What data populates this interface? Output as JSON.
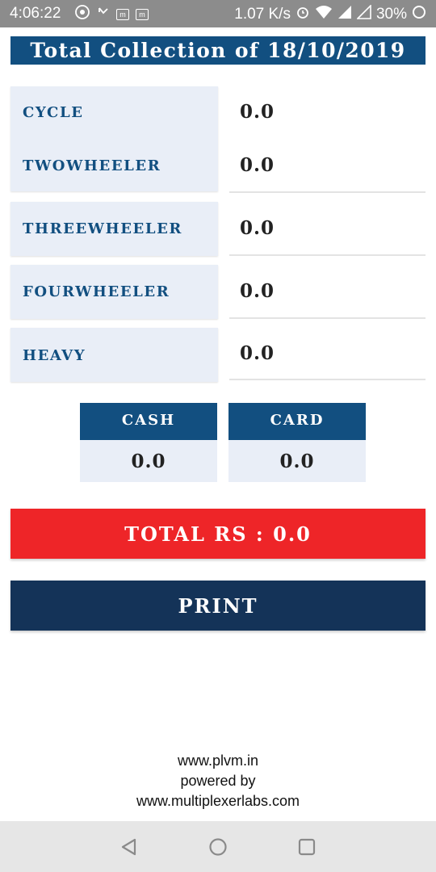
{
  "status_bar": {
    "time": "4:06:22",
    "network_speed": "1.07 K/s",
    "battery": "30%",
    "icons": [
      "music-icon",
      "missed-call-icon",
      "m-app-icon",
      "m-app-icon",
      "alarm-icon",
      "wifi-icon",
      "signal-icon",
      "signal-icon",
      "battery-icon"
    ],
    "app_icon_letter": "m"
  },
  "header": {
    "title": "Total Collection of 18/10/2019"
  },
  "categories": [
    {
      "label": "CYCLE",
      "value": "0.0"
    },
    {
      "label": "TWOWHEELER",
      "value": "0.0"
    },
    {
      "label": "THREEWHEELER",
      "value": "0.0"
    },
    {
      "label": "FOURWHEELER",
      "value": "0.0"
    },
    {
      "label": "HEAVY",
      "value": "0.0"
    }
  ],
  "payment": {
    "cash_label": "CASH",
    "cash_value": "0.0",
    "card_label": "CARD",
    "card_value": "0.0"
  },
  "total": {
    "text": "TOTAL RS : 0.0"
  },
  "print_button": {
    "label": "PRINT"
  },
  "footer": {
    "line1": "www.plvm.in",
    "line2": "powered by",
    "line3": "www.multiplexerlabs.com"
  },
  "nav_bar": {
    "icons": [
      "back-icon",
      "home-icon",
      "recents-icon"
    ]
  },
  "colors": {
    "header_blue": "#124f80",
    "label_bg": "#e9eef7",
    "total_red": "#ee2528",
    "print_navy": "#143358",
    "status_gray": "#8c8c8c"
  }
}
